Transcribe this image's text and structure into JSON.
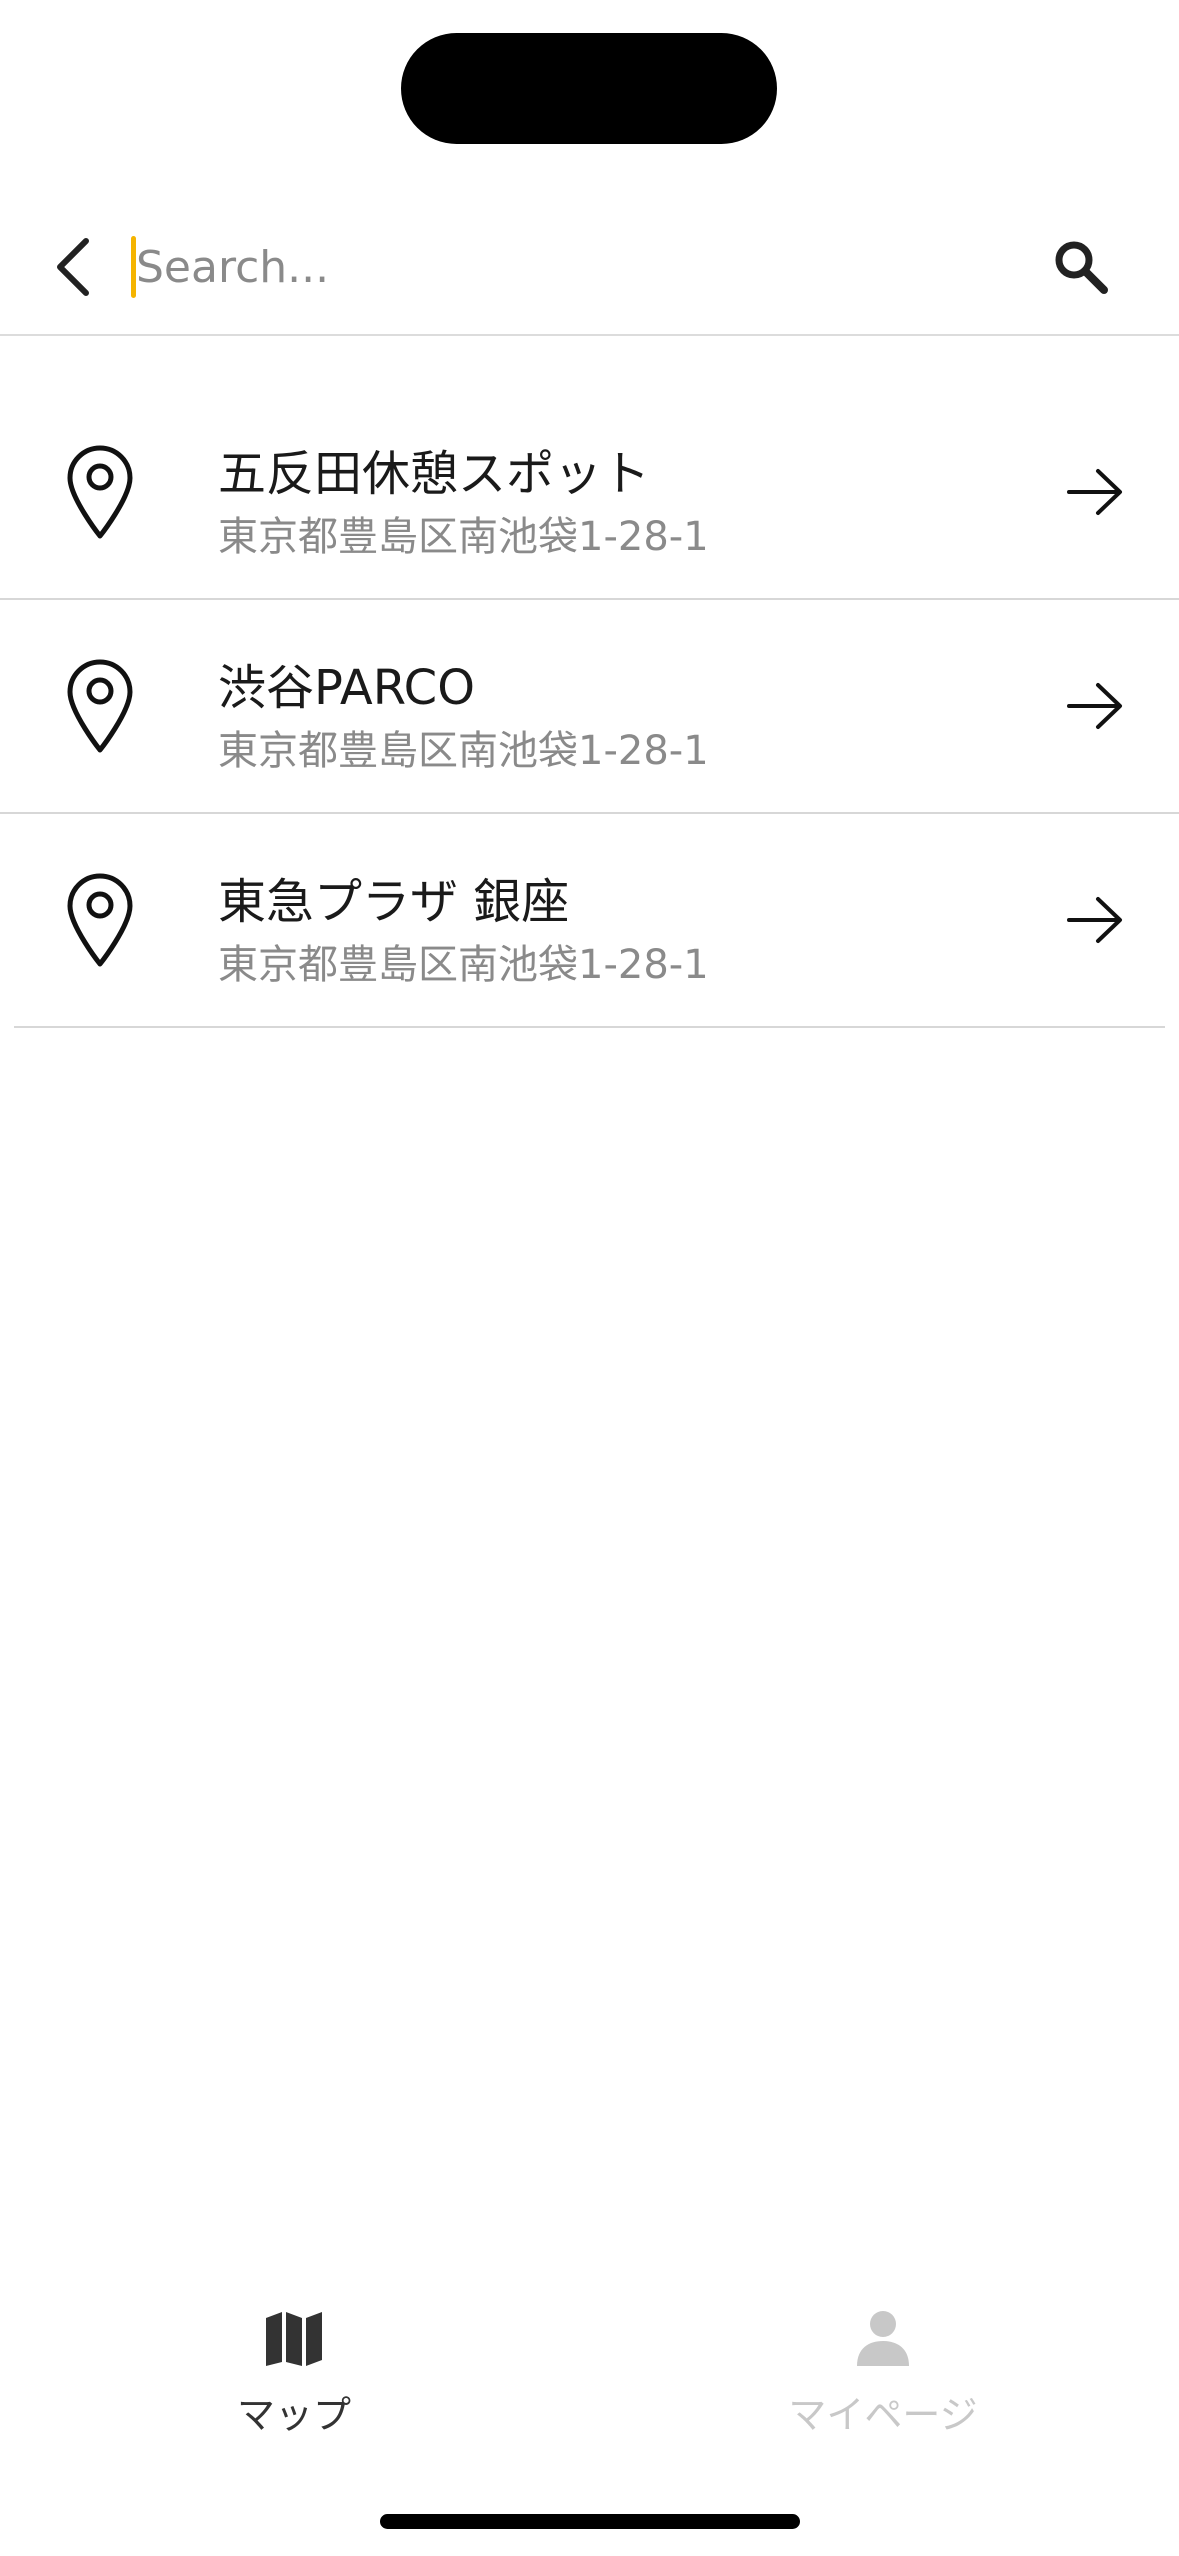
{
  "search": {
    "placeholder": "Search...",
    "value": ""
  },
  "results": [
    {
      "title": "五反田休憩スポット",
      "address": "東京都豊島区南池袋1-28-1"
    },
    {
      "title": "渋谷PARCO",
      "address": "東京都豊島区南池袋1-28-1"
    },
    {
      "title": "東急プラザ 銀座",
      "address": "東京都豊島区南池袋1-28-1"
    }
  ],
  "tabs": [
    {
      "label": "マップ",
      "icon": "map-icon",
      "active": true
    },
    {
      "label": "マイページ",
      "icon": "person-icon",
      "active": false
    }
  ],
  "colors": {
    "caret": "#F5B400",
    "active_tab": "#333333",
    "inactive_tab": "#C8C8C8",
    "secondary_text": "#8A8A8A"
  }
}
